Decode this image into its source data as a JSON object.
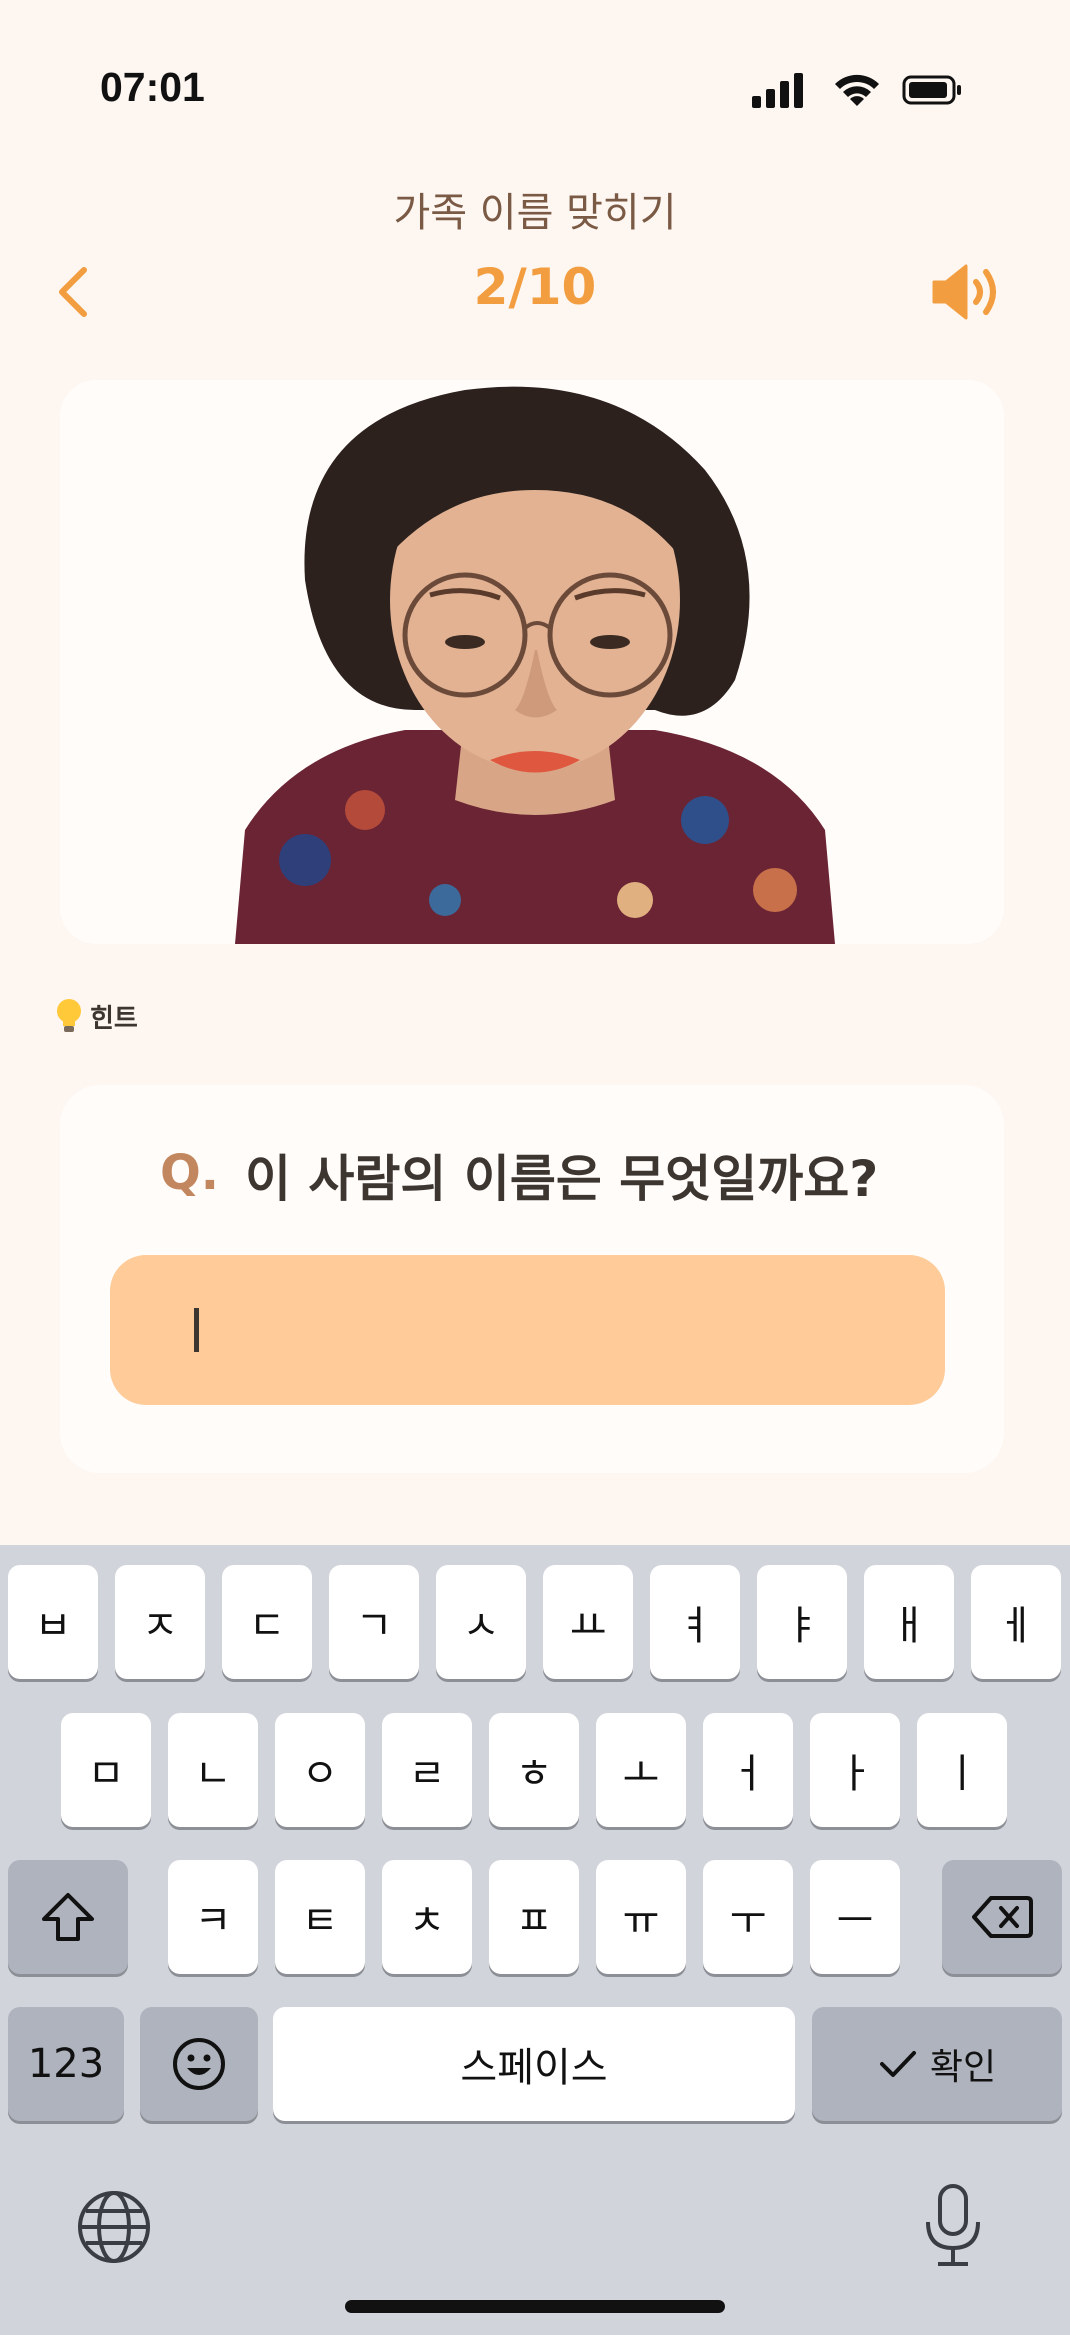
{
  "status_bar": {
    "time": "07:01",
    "icons": [
      "cellular-signal-icon",
      "wifi-icon",
      "battery-icon"
    ]
  },
  "header": {
    "title": "가족 이름 맞히기",
    "progress": "2/10",
    "back_icon": "chevron-left-icon",
    "sound_icon": "speaker-icon"
  },
  "photo": {
    "description_icon": "person-photo"
  },
  "hint": {
    "icon": "lightbulb-icon",
    "label": "힌트"
  },
  "question": {
    "marker": "Q.",
    "text": "이 사람의 이름은 무엇일까요?",
    "answer_value": ""
  },
  "keyboard": {
    "row1": [
      "ㅂ",
      "ㅈ",
      "ㄷ",
      "ㄱ",
      "ㅅ",
      "ㅛ",
      "ㅕ",
      "ㅑ",
      "ㅐ",
      "ㅔ"
    ],
    "row2": [
      "ㅁ",
      "ㄴ",
      "ㅇ",
      "ㄹ",
      "ㅎ",
      "ㅗ",
      "ㅓ",
      "ㅏ",
      "ㅣ"
    ],
    "row3": [
      "ㅋ",
      "ㅌ",
      "ㅊ",
      "ㅍ",
      "ㅠ",
      "ㅜ",
      "ㅡ"
    ],
    "numbers_label": "123",
    "space_label": "스페이스",
    "confirm_label": "확인"
  },
  "colors": {
    "background": "#fdf6f1",
    "accent": "#f29d3f",
    "input_fill": "#ffcb98",
    "question_marker": "#c2875e"
  }
}
